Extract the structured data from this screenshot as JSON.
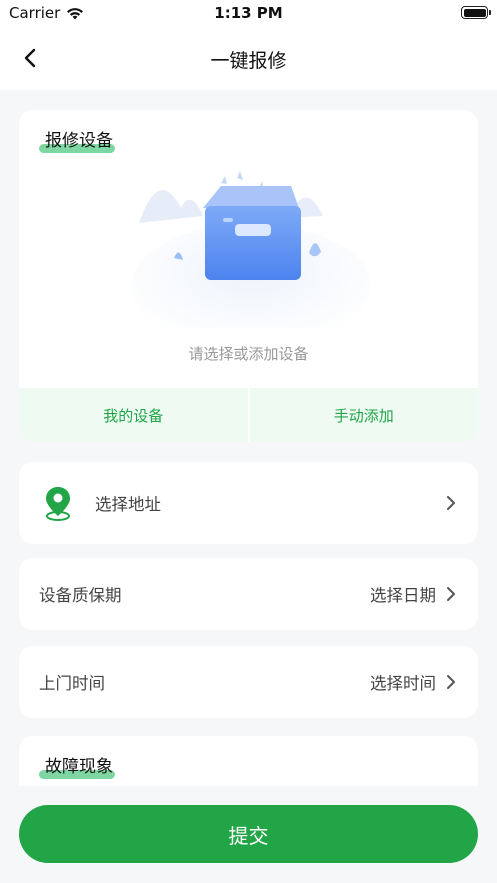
{
  "status_bar": {
    "carrier": "Carrier",
    "time": "1:13 PM"
  },
  "nav": {
    "title": "一键报修"
  },
  "device_section": {
    "title": "报修设备",
    "empty_text": "请选择或添加设备",
    "my_devices_label": "我的设备",
    "manual_add_label": "手动添加"
  },
  "address": {
    "label": "选择地址"
  },
  "warranty": {
    "label": "设备质保期",
    "value": "选择日期"
  },
  "visit_time": {
    "label": "上门时间",
    "value": "选择时间"
  },
  "fault_section": {
    "title": "故障现象"
  },
  "submit": {
    "label": "提交"
  },
  "colors": {
    "accent": "#22a546",
    "highlight": "#7ed6a2",
    "light_green": "#eefaf2"
  }
}
